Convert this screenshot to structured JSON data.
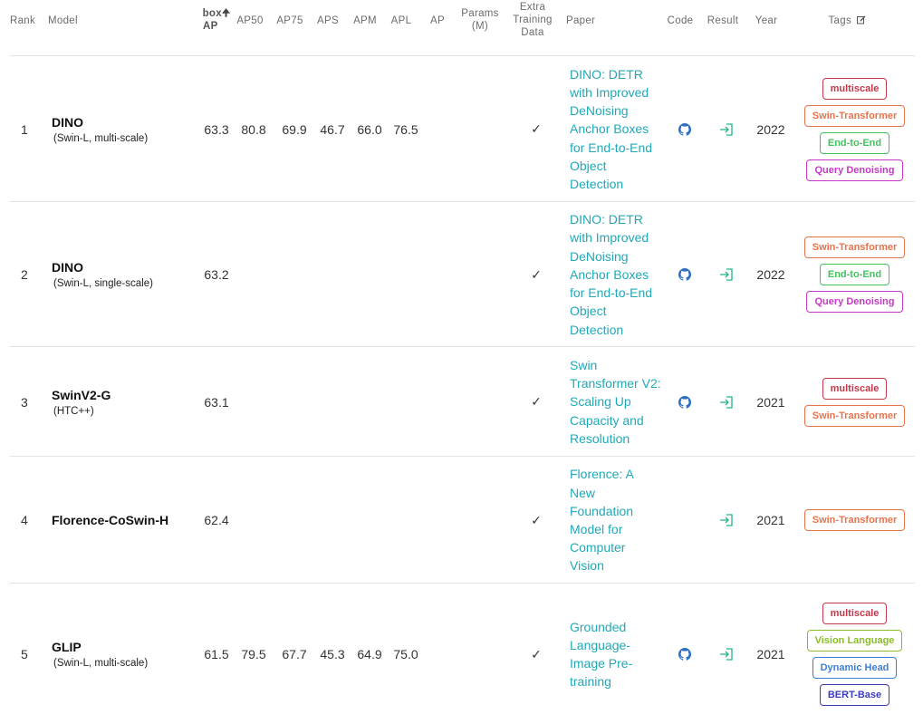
{
  "header": {
    "rank": "Rank",
    "model": "Model",
    "box_ap_line1": "box",
    "box_ap_line2": "AP",
    "ap50": "AP50",
    "ap75": "AP75",
    "aps": "APS",
    "apm": "APM",
    "apl": "APL",
    "ap": "AP",
    "params_line1": "Params",
    "params_line2": "(M)",
    "extra_line1": "Extra",
    "extra_line2": "Training",
    "extra_line3": "Data",
    "paper": "Paper",
    "code": "Code",
    "result": "Result",
    "year": "Year",
    "tags": "Tags"
  },
  "rows": [
    {
      "rank": "1",
      "model": "DINO",
      "sub": "(Swin-L, multi-scale)",
      "box_ap": "63.3",
      "ap50": "80.8",
      "ap75": "69.9",
      "aps": "46.7",
      "apm": "66.0",
      "apl": "76.5",
      "extra": "✓",
      "paper": [
        "DINO: DETR",
        "with Improved",
        "DeNoising",
        "Anchor Boxes",
        "for End-to-End",
        "Object",
        "Detection"
      ],
      "has_code": true,
      "year": "2022",
      "tags": [
        "multiscale",
        "Swin-Transformer",
        "End-to-End",
        "Query Denoising"
      ]
    },
    {
      "rank": "2",
      "model": "DINO",
      "sub": "(Swin-L, single-scale)",
      "box_ap": "63.2",
      "ap50": "",
      "ap75": "",
      "aps": "",
      "apm": "",
      "apl": "",
      "extra": "✓",
      "paper": [
        "DINO: DETR",
        "with Improved",
        "DeNoising",
        "Anchor Boxes",
        "for End-to-End",
        "Object",
        "Detection"
      ],
      "has_code": true,
      "year": "2022",
      "tags": [
        "Swin-Transformer",
        "End-to-End",
        "Query Denoising"
      ]
    },
    {
      "rank": "3",
      "model": "SwinV2-G",
      "sub": "(HTC++)",
      "box_ap": "63.1",
      "ap50": "",
      "ap75": "",
      "aps": "",
      "apm": "",
      "apl": "",
      "extra": "✓",
      "paper": [
        "Swin",
        "Transformer V2:",
        "Scaling Up",
        "Capacity and",
        "Resolution"
      ],
      "has_code": true,
      "year": "2021",
      "tags": [
        "multiscale",
        "Swin-Transformer"
      ]
    },
    {
      "rank": "4",
      "model": "Florence-CoSwin-H",
      "sub": "",
      "box_ap": "62.4",
      "ap50": "",
      "ap75": "",
      "aps": "",
      "apm": "",
      "apl": "",
      "extra": "✓",
      "paper": [
        "Florence: A",
        "New",
        "Foundation",
        "Model for",
        "Computer",
        "Vision"
      ],
      "has_code": false,
      "year": "2021",
      "tags": [
        "Swin-Transformer"
      ]
    },
    {
      "rank": "5",
      "model": "GLIP",
      "sub": "(Swin-L, multi-scale)",
      "box_ap": "61.5",
      "ap50": "79.5",
      "ap75": "67.7",
      "aps": "45.3",
      "apm": "64.9",
      "apl": "75.0",
      "extra": "✓",
      "paper": [
        "Grounded",
        "Language-",
        "Image Pre-",
        "training"
      ],
      "has_code": true,
      "year": "2021",
      "tags": [
        "multiscale",
        "Vision Language",
        "Dynamic Head",
        "BERT-Base"
      ]
    }
  ],
  "tag_colors": {
    "multiscale": "#c5394b",
    "Swin-Transformer": "#e8734a",
    "End-to-End": "#3fc45c",
    "Query Denoising": "#c638c8",
    "Vision Language": "#8bbc2a",
    "Dynamic Head": "#3d7fd6",
    "BERT-Base": "#3c3cbf"
  },
  "icons": {
    "sort": "arrow-up-icon",
    "edit": "edit-icon",
    "code": "github-icon",
    "result": "result-link-icon"
  }
}
